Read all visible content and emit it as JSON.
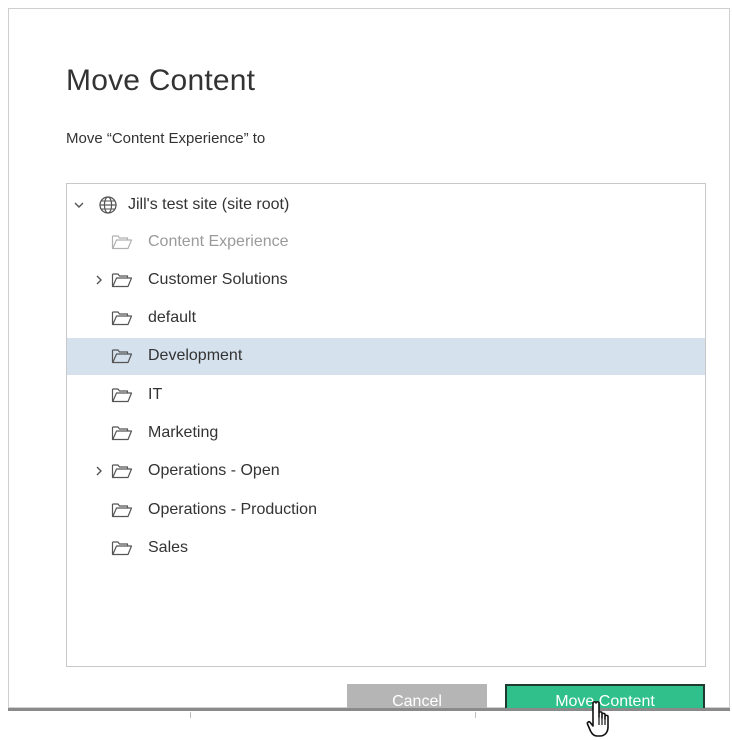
{
  "dialog": {
    "title": "Move Content",
    "subtitle": "Move “Content Experience” to"
  },
  "tree": {
    "root": {
      "label": "Jill's test site (site root)",
      "icon": "globe-icon",
      "expanded": true
    },
    "items": [
      {
        "label": "Content Experience",
        "icon": "folder-icon",
        "has_children": false,
        "disabled": true,
        "selected": false
      },
      {
        "label": "Customer Solutions",
        "icon": "folder-icon",
        "has_children": true,
        "disabled": false,
        "selected": false
      },
      {
        "label": "default",
        "icon": "folder-icon",
        "has_children": false,
        "disabled": false,
        "selected": false
      },
      {
        "label": "Development",
        "icon": "folder-icon",
        "has_children": false,
        "disabled": false,
        "selected": true
      },
      {
        "label": "IT",
        "icon": "folder-icon",
        "has_children": false,
        "disabled": false,
        "selected": false
      },
      {
        "label": "Marketing",
        "icon": "folder-icon",
        "has_children": false,
        "disabled": false,
        "selected": false
      },
      {
        "label": "Operations - Open",
        "icon": "folder-icon",
        "has_children": true,
        "disabled": false,
        "selected": false
      },
      {
        "label": "Operations - Production",
        "icon": "folder-icon",
        "has_children": false,
        "disabled": false,
        "selected": false
      },
      {
        "label": "Sales",
        "icon": "folder-icon",
        "has_children": false,
        "disabled": false,
        "selected": false
      }
    ]
  },
  "buttons": {
    "cancel_label": "Cancel",
    "move_label": "Move Content"
  },
  "colors": {
    "selected_row": "#d5e1ec",
    "primary_button": "#2fc08b",
    "cancel_button": "#b5b5b5",
    "text": "#333333",
    "disabled_text": "#9a9a9a"
  }
}
